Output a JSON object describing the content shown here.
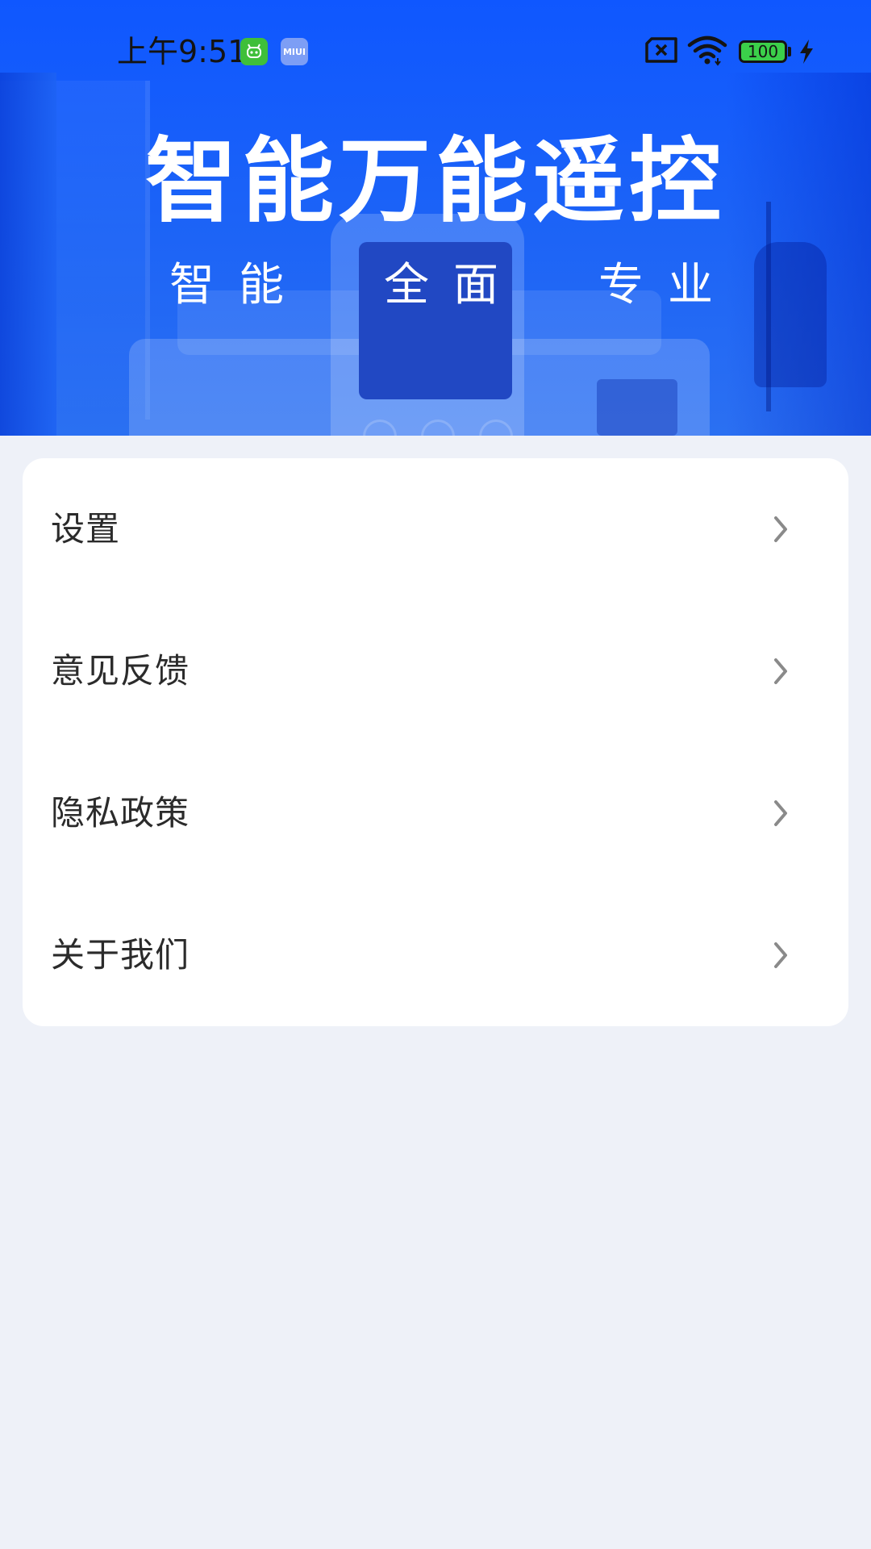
{
  "status_bar": {
    "time": "上午9:51",
    "app_icon_1": "android-robot-icon",
    "app_icon_2": "MIUI",
    "sim_icon": "no-sim-icon",
    "wifi_icon": "wifi-icon",
    "battery_level": "100",
    "charging_icon": "lightning-icon"
  },
  "hero": {
    "title": "智能万能遥控",
    "subtitles": [
      "智能",
      "全面",
      "专业"
    ],
    "background_color": "#1560ff"
  },
  "menu": {
    "items": [
      {
        "label": "设置",
        "icon": "chevron-right-icon"
      },
      {
        "label": "意见反馈",
        "icon": "chevron-right-icon"
      },
      {
        "label": "隐私政策",
        "icon": "chevron-right-icon"
      },
      {
        "label": "关于我们",
        "icon": "chevron-right-icon"
      }
    ]
  },
  "colors": {
    "page_background": "#eef1f8",
    "card_background": "#ffffff",
    "label_text": "#2b2b2b",
    "chevron": "#8a8a8a",
    "accent_blue": "#1560ff"
  }
}
